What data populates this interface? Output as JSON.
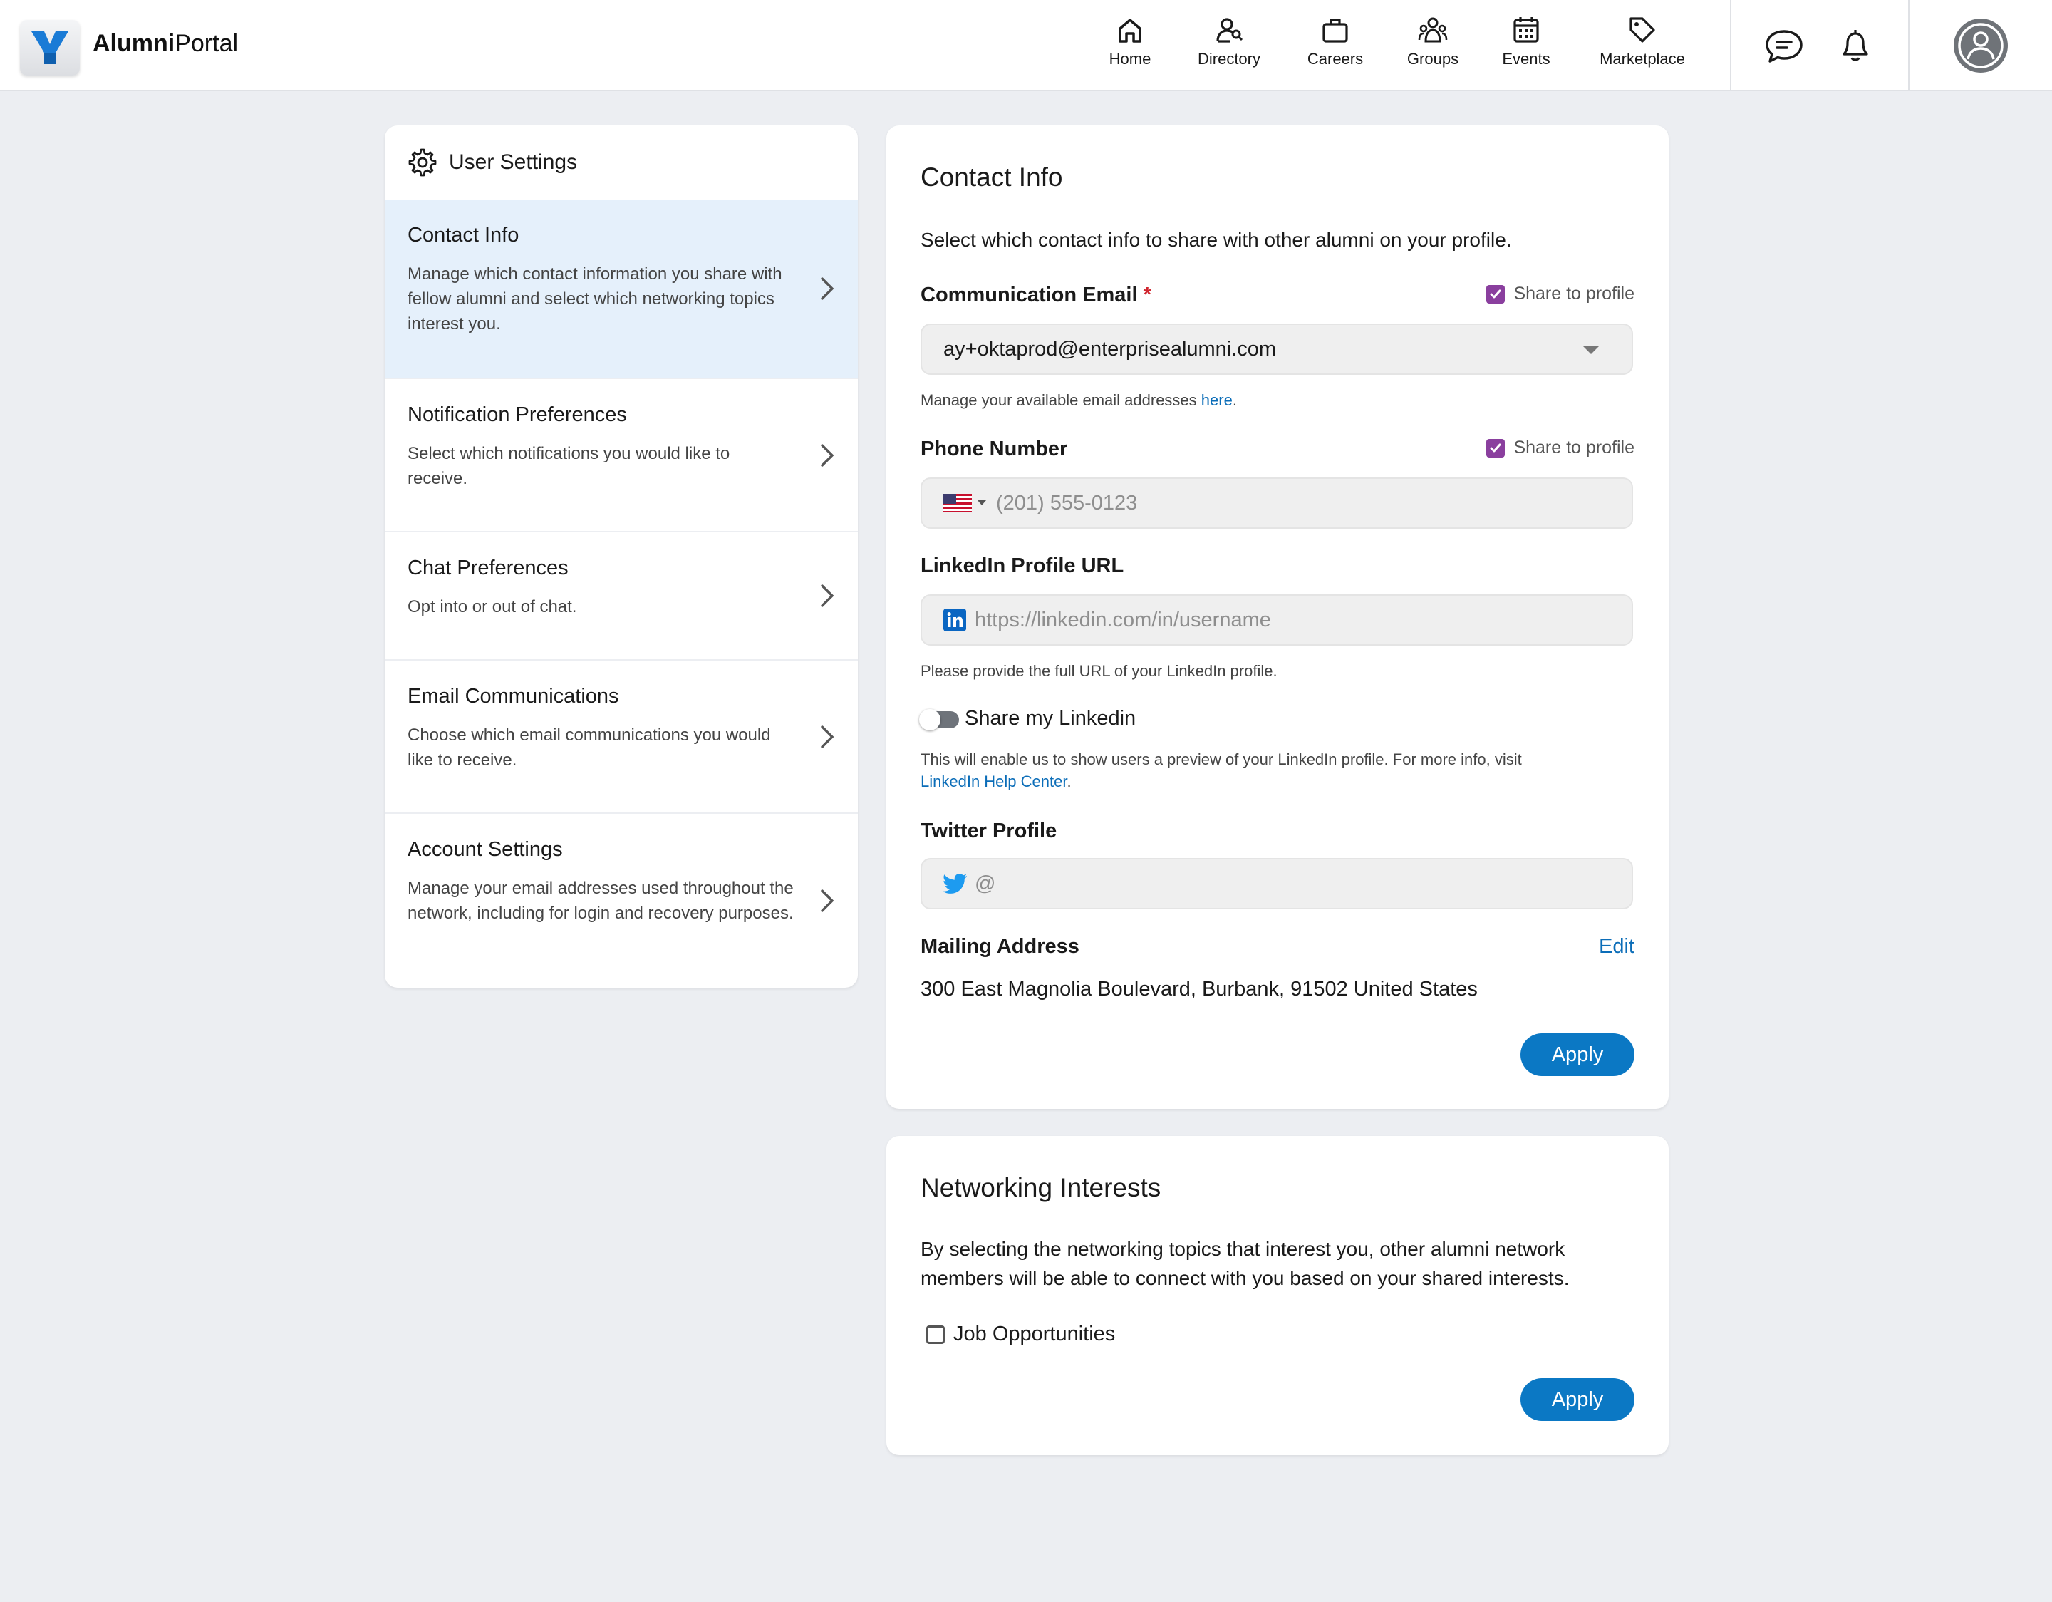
{
  "header": {
    "brand_bold": "Alumni",
    "brand_rest": "Portal",
    "nav": [
      {
        "label": "Home",
        "icon": "home-icon"
      },
      {
        "label": "Directory",
        "icon": "directory-icon"
      },
      {
        "label": "Careers",
        "icon": "briefcase-icon"
      },
      {
        "label": "Groups",
        "icon": "groups-icon"
      },
      {
        "label": "Events",
        "icon": "calendar-icon"
      },
      {
        "label": "Marketplace",
        "icon": "tag-icon"
      }
    ],
    "actions": [
      "chat-icon",
      "bell-icon",
      "avatar-icon"
    ]
  },
  "sidebar": {
    "title": "User Settings",
    "items": [
      {
        "title": "Contact Info",
        "desc": "Manage which contact information you share with fellow alumni and select which networking topics interest you.",
        "active": true
      },
      {
        "title": "Notification Preferences",
        "desc": "Select which notifications you would like to receive."
      },
      {
        "title": "Chat Preferences",
        "desc": "Opt into or out of chat."
      },
      {
        "title": "Email Communications",
        "desc": "Choose which email communications you would like to receive."
      },
      {
        "title": "Account Settings",
        "desc": "Manage your email addresses used throughout the network, including for login and recovery purposes."
      }
    ]
  },
  "contact": {
    "title": "Contact Info",
    "lead": "Select which contact info to share with other alumni on your profile.",
    "email": {
      "label": "Communication Email",
      "required_mark": "*",
      "share_label": "Share to profile",
      "value": "ay+oktaprod@enterprisealumni.com",
      "hint_prefix": "Manage your available email addresses ",
      "hint_link": "here",
      "hint_suffix": "."
    },
    "phone": {
      "label": "Phone Number",
      "share_label": "Share to profile",
      "placeholder": "(201) 555-0123"
    },
    "linkedin": {
      "label": "LinkedIn Profile URL",
      "placeholder": "https://linkedin.com/in/username",
      "hint": "Please provide the full URL of your LinkedIn profile.",
      "toggle_label": "Share my Linkedin",
      "toggle_on": false,
      "info_text": "This will enable us to show users a preview of your LinkedIn profile. For more info, visit",
      "info_link": "LinkedIn Help Center",
      "info_suffix": "."
    },
    "twitter": {
      "label": "Twitter Profile",
      "prefix": "@"
    },
    "mailing": {
      "label": "Mailing Address",
      "edit_label": "Edit",
      "address": "300 East Magnolia Boulevard, Burbank, 91502 United States"
    },
    "apply_label": "Apply"
  },
  "networking": {
    "title": "Networking Interests",
    "lead": "By selecting the networking topics that interest you, other alumni network members will be able to connect with you based on your shared interests.",
    "options": [
      {
        "label": "Job Opportunities",
        "checked": false
      }
    ],
    "apply_label": "Apply"
  },
  "colors": {
    "accent": "#0b78c4",
    "checkbox": "#8a3f9e",
    "active_item_bg": "#e5f0fb",
    "page_bg": "#eceef2"
  }
}
